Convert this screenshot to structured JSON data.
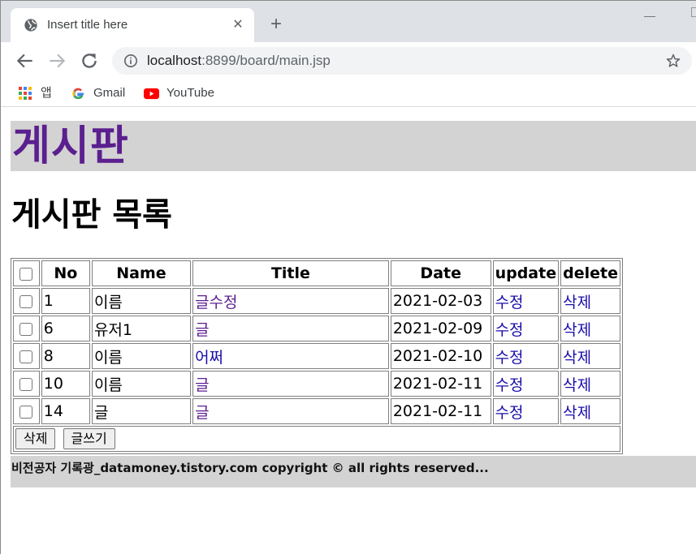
{
  "browser": {
    "tab_title": "Insert title here",
    "url_host": "localhost",
    "url_rest": ":8899/board/main.jsp",
    "bookmarks": [
      {
        "label": "앱",
        "icon": "apps-grid-icon"
      },
      {
        "label": "Gmail",
        "icon": "google-g-icon"
      },
      {
        "label": "YouTube",
        "icon": "youtube-icon"
      }
    ]
  },
  "page": {
    "header_title": "게시판",
    "list_title": "게시판 목록",
    "columns": [
      "No",
      "Name",
      "Title",
      "Date",
      "update",
      "delete"
    ],
    "rows": [
      {
        "no": "1",
        "name": "이름",
        "title": "글수정",
        "date": "2021-02-03",
        "update": "수정",
        "delete": "삭제"
      },
      {
        "no": "6",
        "name": "유저1",
        "title": "글",
        "date": "2021-02-09",
        "update": "수정",
        "delete": "삭제"
      },
      {
        "no": "8",
        "name": "이름",
        "title": "어쩌",
        "date": "2021-02-10",
        "update": "수정",
        "delete": "삭제"
      },
      {
        "no": "10",
        "name": "이름",
        "title": "글",
        "date": "2021-02-11",
        "update": "수정",
        "delete": "삭제"
      },
      {
        "no": "14",
        "name": "글",
        "title": "글",
        "date": "2021-02-11",
        "update": "수정",
        "delete": "삭제"
      }
    ],
    "delete_button": "삭제",
    "write_button": "글쓰기",
    "footer": "비전공자 기록광_datamoney.tistory.com copyright © all rights reserved..."
  },
  "colors": {
    "header_bg": "#d3d3d3",
    "header_text": "#5b1f8f",
    "link": "#1a0dab",
    "visited_link": "#5b1f8f"
  }
}
